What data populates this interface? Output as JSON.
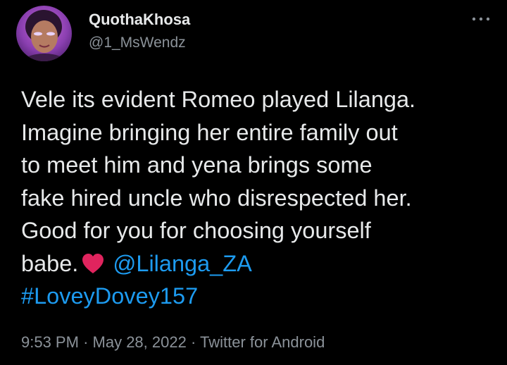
{
  "author": {
    "display_name": "QuothaKhosa",
    "handle": "@1_MsWendz",
    "avatar_icon": "profile-photo"
  },
  "more_menu_icon": "ellipsis-icon",
  "tweet": {
    "lines": [
      "Vele its evident Romeo played Lilanga.",
      "Imagine bringing her entire family out",
      "to meet him and yena brings some",
      "fake hired uncle who disrespected her.",
      "Good for you for choosing yourself"
    ],
    "last_line_prefix": "babe.",
    "emoji": "red-heart-icon",
    "mention": "@Lilanga_ZA",
    "hashtag": "#LoveyDovey157"
  },
  "meta": {
    "time": "9:53 PM",
    "separator": "·",
    "date": "May 28, 2022",
    "source": "Twitter for Android"
  },
  "colors": {
    "background": "#000000",
    "text": "#e7e9ea",
    "secondary": "#8b9299",
    "link": "#1d9bf0",
    "heart": "#e0245e"
  }
}
